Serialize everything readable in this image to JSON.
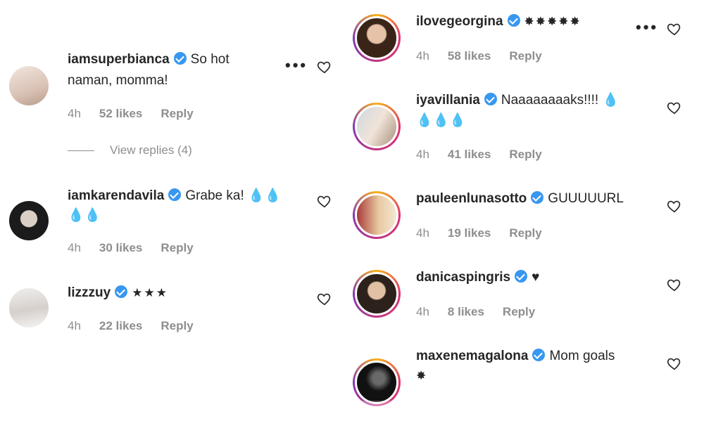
{
  "left_comments": [
    {
      "username": "iamsuperbianca",
      "text": "So hot",
      "text2": "naman, momma!",
      "time": "4h",
      "likes": "52 likes",
      "reply": "Reply"
    },
    {
      "username": "iamkarendavila",
      "text": "Grabe ka! 💧💧",
      "text2": "💧💧",
      "time": "4h",
      "likes": "30 likes",
      "reply": "Reply"
    },
    {
      "username": "lizzzuy",
      "text": "★★★",
      "text2": "",
      "time": "4h",
      "likes": "22 likes",
      "reply": "Reply"
    }
  ],
  "view_replies": "View replies (4)",
  "more_dots": "•••",
  "right_comments": [
    {
      "username": "ilovegeorgina",
      "text": "✸✸✸✸✸",
      "text2": "",
      "time": "4h",
      "likes": "58 likes",
      "reply": "Reply"
    },
    {
      "username": "iyavillania",
      "text": "Naaaaaaaaks!!!! 💧",
      "text2": "💧💧💧",
      "time": "4h",
      "likes": "41 likes",
      "reply": "Reply"
    },
    {
      "username": "pauleenlunasotto",
      "text": "GUUUUURL",
      "text2": "",
      "time": "4h",
      "likes": "19 likes",
      "reply": "Reply"
    },
    {
      "username": "danicaspingris",
      "text": "♥",
      "text2": "",
      "time": "4h",
      "likes": "8 likes",
      "reply": "Reply"
    },
    {
      "username": "maxenemagalona",
      "text": "Mom goals",
      "text2": "✸",
      "time": "",
      "likes": "",
      "reply": ""
    }
  ]
}
